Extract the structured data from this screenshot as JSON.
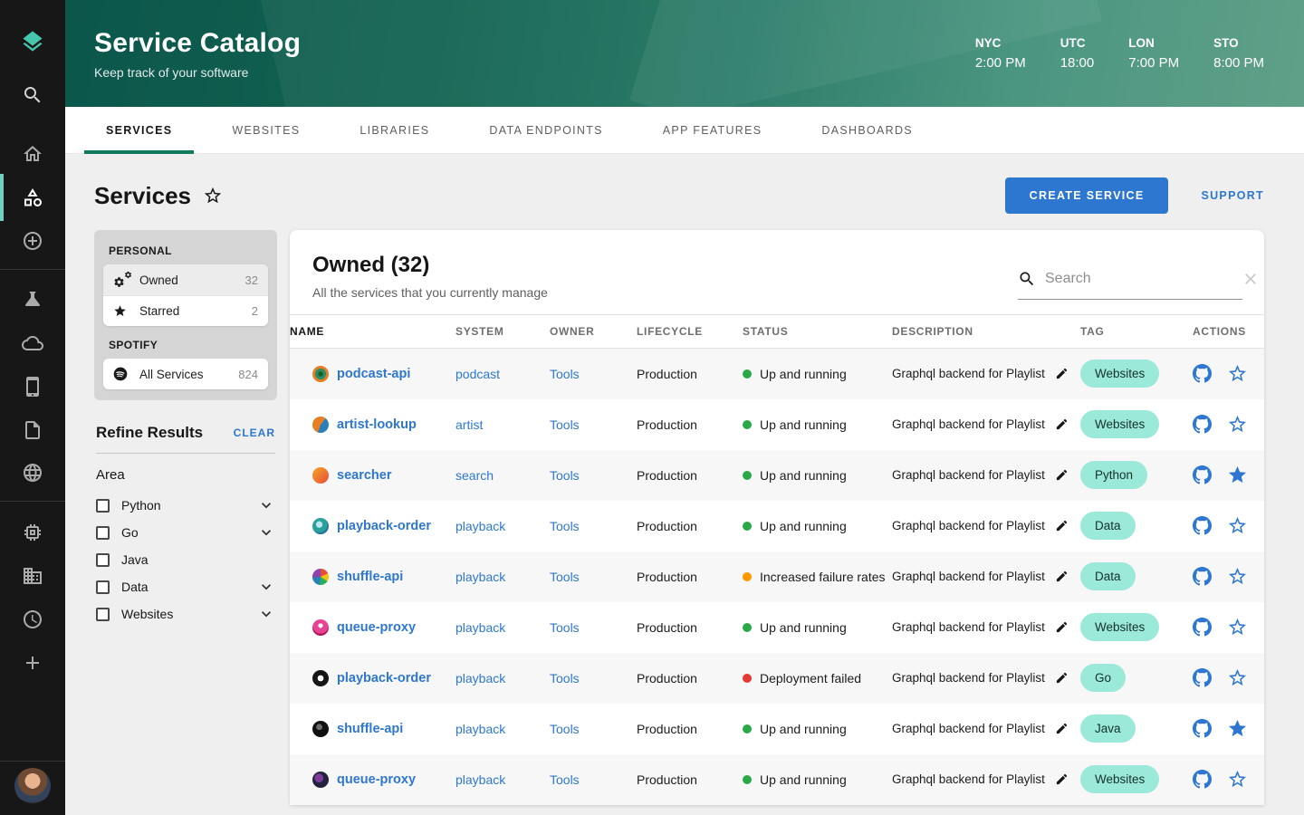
{
  "hero": {
    "title": "Service Catalog",
    "subtitle": "Keep track of your software",
    "clocks": [
      {
        "label": "NYC",
        "time": "2:00 PM"
      },
      {
        "label": "UTC",
        "time": "18:00"
      },
      {
        "label": "LON",
        "time": "7:00 PM"
      },
      {
        "label": "STO",
        "time": "8:00 PM"
      }
    ]
  },
  "tabs": [
    {
      "label": "SERVICES",
      "active": true
    },
    {
      "label": "WEBSITES",
      "active": false
    },
    {
      "label": "LIBRARIES",
      "active": false
    },
    {
      "label": "DATA ENDPOINTS",
      "active": false
    },
    {
      "label": "APP FEATURES",
      "active": false
    },
    {
      "label": "DASHBOARDS",
      "active": false
    }
  ],
  "page": {
    "title": "Services",
    "create_button": "CREATE SERVICE",
    "support_label": "SUPPORT"
  },
  "sidebar": {
    "personal_label": "PERSONAL",
    "owned_label": "Owned",
    "owned_count": "32",
    "starred_label": "Starred",
    "starred_count": "2",
    "org_label": "SPOTIFY",
    "all_services_label": "All Services",
    "all_services_count": "824"
  },
  "refine": {
    "title": "Refine Results",
    "clear_label": "CLEAR",
    "group_label": "Area",
    "options": [
      {
        "label": "Python",
        "expandable": true
      },
      {
        "label": "Go",
        "expandable": true
      },
      {
        "label": "Java",
        "expandable": false
      },
      {
        "label": "Data",
        "expandable": true
      },
      {
        "label": "Websites",
        "expandable": true
      }
    ]
  },
  "table": {
    "title": "Owned (32)",
    "subtitle": "All the services that you currently manage",
    "search_placeholder": "Search",
    "columns": [
      {
        "label": "NAME",
        "primary": true
      },
      {
        "label": "SYSTEM",
        "primary": false
      },
      {
        "label": "OWNER",
        "primary": false
      },
      {
        "label": "LIFECYCLE",
        "primary": false
      },
      {
        "label": "STATUS",
        "primary": false
      },
      {
        "label": "DESCRIPTION",
        "primary": false
      },
      {
        "label": "TAG",
        "primary": false
      },
      {
        "label": "ACTIONS",
        "primary": false
      }
    ],
    "rows": [
      {
        "name": "podcast-api",
        "system": "podcast",
        "owner": "Tools",
        "lifecycle": "Production",
        "status": "Up and running",
        "status_color": "#2BA84A",
        "description": "Graphql backend for Playlist",
        "tag": "Websites",
        "starred": false,
        "avatar": "radial-gradient(circle at 50% 50%, #1b5e20 0 22%, #2e8b6a 22% 48%, #e67e22 48% 74%, #c0392b 74% 100%)"
      },
      {
        "name": "artist-lookup",
        "system": "artist",
        "owner": "Tools",
        "lifecycle": "Production",
        "status": "Up and running",
        "status_color": "#2BA84A",
        "description": "Graphql backend for Playlist",
        "tag": "Websites",
        "starred": false,
        "avatar": "conic-gradient(from 200deg, #e67e22 0 55%, #2980b9 55% 100%)"
      },
      {
        "name": "searcher",
        "system": "search",
        "owner": "Tools",
        "lifecycle": "Production",
        "status": "Up and running",
        "status_color": "#2BA84A",
        "description": "Graphql backend for Playlist",
        "tag": "Python",
        "starred": true,
        "avatar": "linear-gradient(135deg, #f5a623, #e74c3c)"
      },
      {
        "name": "playback-order",
        "system": "playback",
        "owner": "Tools",
        "lifecycle": "Production",
        "status": "Up and running",
        "status_color": "#2BA84A",
        "description": "Graphql backend for Playlist",
        "tag": "Data",
        "starred": false,
        "avatar": "radial-gradient(circle at 42% 40%, #bfe6f5 0 24%, #2aa198 24% 60%, #2471a3 60% 100%)"
      },
      {
        "name": "shuffle-api",
        "system": "playback",
        "owner": "Tools",
        "lifecycle": "Production",
        "status": "Increased failure rates",
        "status_color": "#FF9800",
        "description": "Graphql backend for Playlist",
        "tag": "Data",
        "starred": false,
        "avatar": "conic-gradient(#e74c3c 0 18%, #f1c40f 18% 34%, #27ae60 34% 52%, #2980b9 52% 74%, #8e44ad 74% 100%)"
      },
      {
        "name": "queue-proxy",
        "system": "playback",
        "owner": "Tools",
        "lifecycle": "Production",
        "status": "Up and running",
        "status_color": "#2BA84A",
        "description": "Graphql backend for Playlist",
        "tag": "Websites",
        "starred": false,
        "avatar": "radial-gradient(circle at 50% 38%, #ffffff 0 18%, #e84393 18% 62%, #ad1457 62% 100%)"
      },
      {
        "name": "playback-order",
        "system": "playback",
        "owner": "Tools",
        "lifecycle": "Production",
        "status": "Deployment failed",
        "status_color": "#E53935",
        "description": "Graphql backend for Playlist",
        "tag": "Go",
        "starred": false,
        "avatar": "radial-gradient(circle at 50% 50%, #ffffff 0 26%, #151515 26% 100%)"
      },
      {
        "name": "shuffle-api",
        "system": "playback",
        "owner": "Tools",
        "lifecycle": "Production",
        "status": "Up and running",
        "status_color": "#2BA84A",
        "description": "Graphql backend for Playlist",
        "tag": "Java",
        "starred": true,
        "avatar": "radial-gradient(circle at 42% 38%, #6b6b6b 0 22%, #101010 22% 100%)"
      },
      {
        "name": "queue-proxy",
        "system": "playback",
        "owner": "Tools",
        "lifecycle": "Production",
        "status": "Up and running",
        "status_color": "#2BA84A",
        "description": "Graphql backend for Playlist",
        "tag": "Websites",
        "starred": false,
        "avatar": "radial-gradient(circle at 40% 40%, #7d3c98 0 32%, #23233f 32% 100%)"
      }
    ]
  },
  "rail_icons": [
    "backstage-logo",
    "search",
    "home",
    "category-catalog",
    "add-circle",
    "flask",
    "cloud",
    "smartphone",
    "document",
    "globe",
    "chip",
    "building",
    "clock",
    "plus",
    "user-avatar"
  ],
  "colors": {
    "accent_blue": "#2E77D0",
    "tag_mint": "#9BE9D8",
    "status_green": "#2BA84A",
    "status_orange": "#FF9800",
    "status_red": "#E53935",
    "rail_teal": "#46C6AE",
    "tab_underline": "#127a5e"
  }
}
